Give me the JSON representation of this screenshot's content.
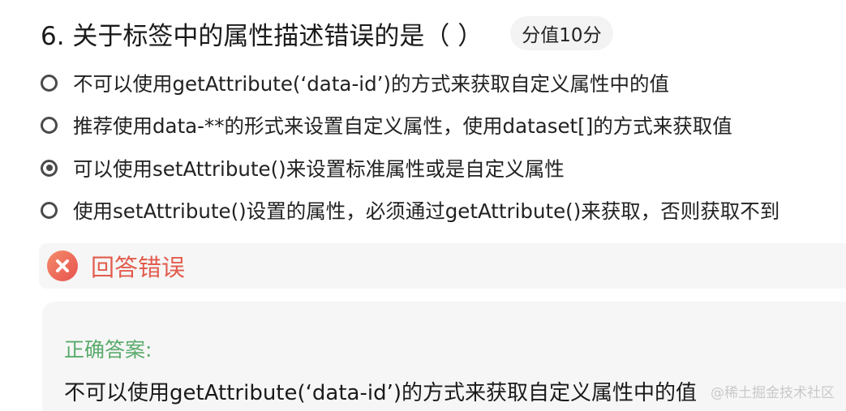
{
  "question": {
    "title": "6. 关于标签中的属性描述错误的是（ ）",
    "score": "分值10分"
  },
  "options": [
    {
      "label": "不可以使用getAttribute(‘data-id’)的方式来获取自定义属性中的值",
      "selected": false
    },
    {
      "label": "推荐使用data-**的形式来设置自定义属性，使用dataset[]的方式来获取值",
      "selected": false
    },
    {
      "label": "可以使用setAttribute()来设置标准属性或是自定义属性",
      "selected": true
    },
    {
      "label": "使用setAttribute()设置的属性，必须通过getAttribute()来获取，否则获取不到",
      "selected": false
    }
  ],
  "result": {
    "icon": "error-x-icon",
    "text": "回答错误",
    "color": "#e25c4e"
  },
  "answer": {
    "label": "正确答案:",
    "text": "不可以使用getAttribute(‘data-id’)的方式来获取自定义属性中的值",
    "label_color": "#5aab6c"
  },
  "watermark": "@稀土掘金技术社区"
}
